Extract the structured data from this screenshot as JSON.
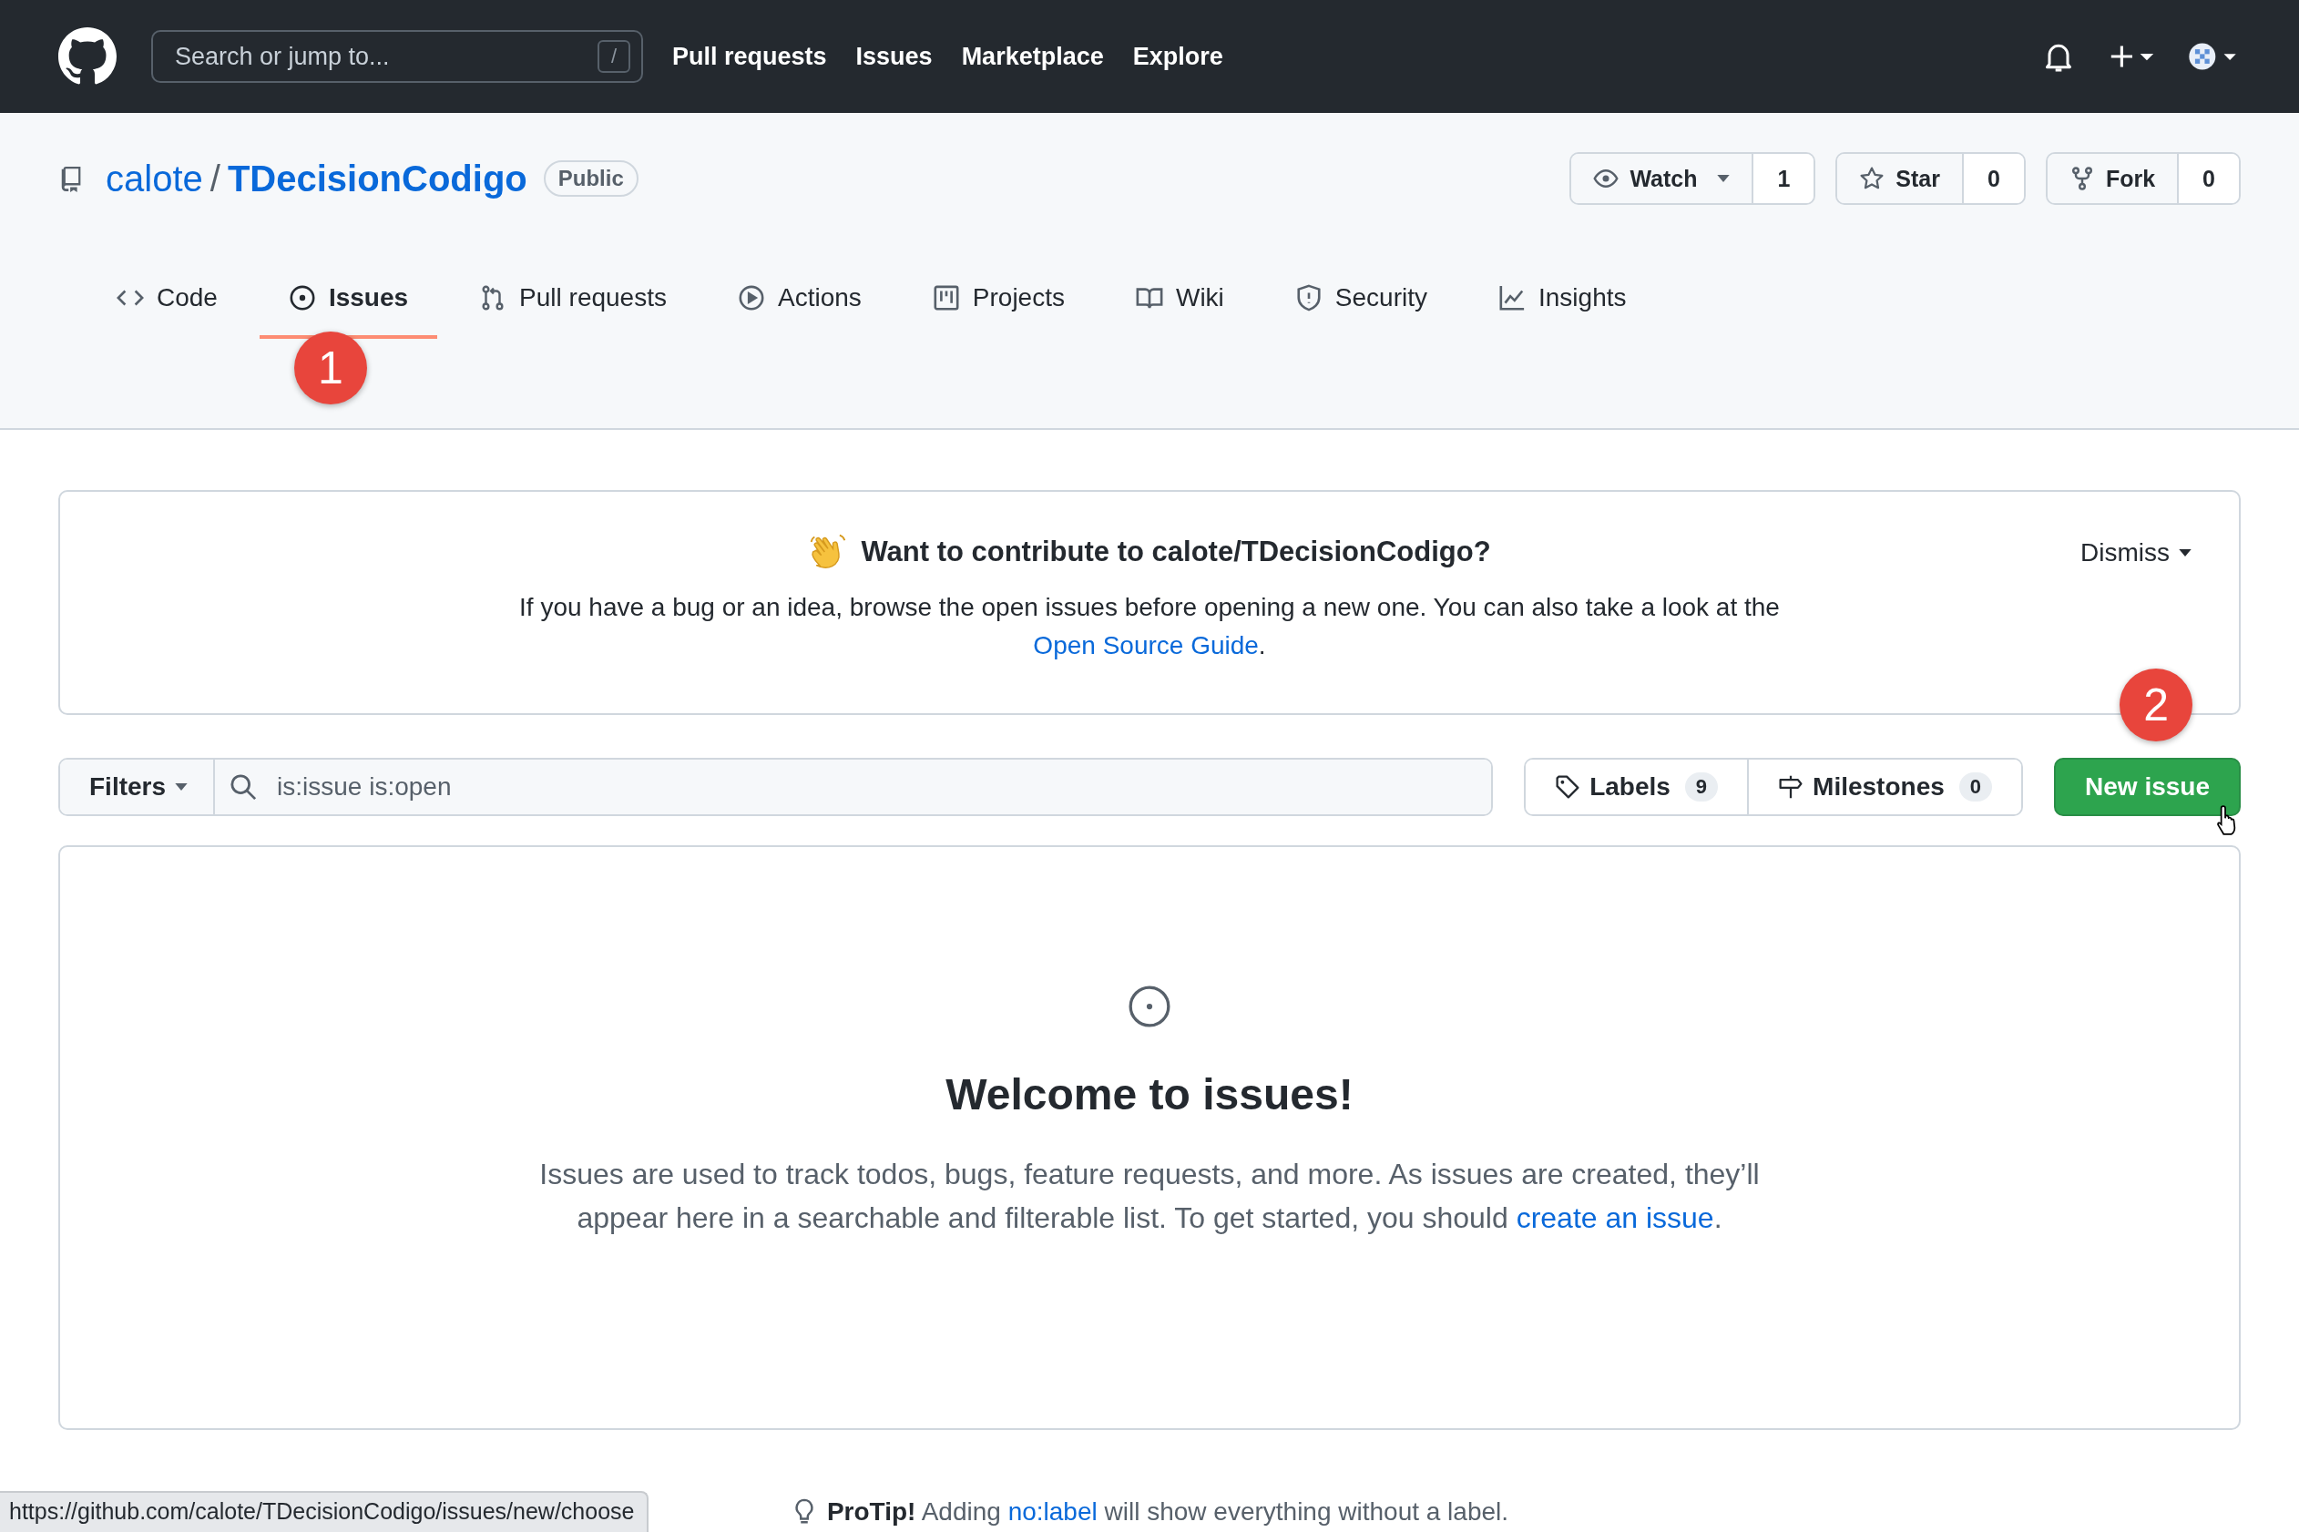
{
  "header": {
    "search_placeholder": "Search or jump to...",
    "search_key": "/",
    "nav": [
      "Pull requests",
      "Issues",
      "Marketplace",
      "Explore"
    ]
  },
  "repo": {
    "owner": "calote",
    "separator": "/",
    "name": "TDecisionCodigo",
    "visibility": "Public",
    "actions": [
      {
        "kind": "watch",
        "label": "Watch",
        "count": "1"
      },
      {
        "kind": "star",
        "label": "Star",
        "count": "0"
      },
      {
        "kind": "fork",
        "label": "Fork",
        "count": "0"
      }
    ]
  },
  "tabs": [
    {
      "kind": "code",
      "label": "Code",
      "selected": false
    },
    {
      "kind": "issues",
      "label": "Issues",
      "selected": true,
      "annotation": "1"
    },
    {
      "kind": "pulls",
      "label": "Pull requests",
      "selected": false
    },
    {
      "kind": "actions",
      "label": "Actions",
      "selected": false
    },
    {
      "kind": "projects",
      "label": "Projects",
      "selected": false
    },
    {
      "kind": "wiki",
      "label": "Wiki",
      "selected": false
    },
    {
      "kind": "security",
      "label": "Security",
      "selected": false
    },
    {
      "kind": "insights",
      "label": "Insights",
      "selected": false
    }
  ],
  "banner": {
    "title": "Want to contribute to calote/TDecisionCodigo?",
    "dismiss": "Dismiss",
    "text": "If you have a bug or an idea, browse the open issues before opening a new one. You can also take a look at the ",
    "link": "Open Source Guide",
    "end": "."
  },
  "filters": {
    "button": "Filters",
    "query": "is:issue is:open",
    "labels": {
      "label": "Labels",
      "count": "9"
    },
    "milestones": {
      "label": "Milestones",
      "count": "0"
    },
    "new_issue": {
      "label": "New issue",
      "annotation": "2"
    }
  },
  "blankslate": {
    "title": "Welcome to issues!",
    "text": "Issues are used to track todos, bugs, feature requests, and more. As issues are created, they’ll appear here in a searchable and filterable list. To get started, you should ",
    "link": "create an issue",
    "end": "."
  },
  "protip": {
    "label": "ProTip!",
    "before": "Adding ",
    "link": "no:label",
    "after": " will show everything without a label."
  },
  "status_url": "https://github.com/calote/TDecisionCodigo/issues/new/choose"
}
